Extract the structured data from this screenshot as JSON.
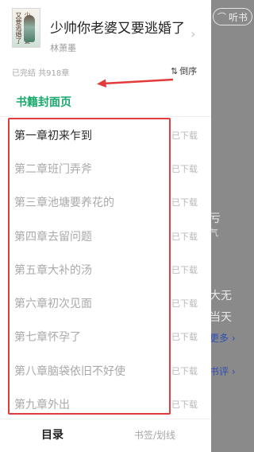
{
  "background": {
    "listen_label": "听书",
    "fragments": [
      "亏",
      "气",
      "大无",
      "当天",
      "更多 ›",
      "书评 ›"
    ]
  },
  "book": {
    "title": "少帅你老婆又要逃婚了",
    "author": "林萧墨",
    "cover_text": "少帅你老婆又要逃婚了"
  },
  "meta": {
    "status": "已完结 共918章",
    "sort_label": "倒序"
  },
  "cover_page_link": "书籍封面页",
  "chapters": [
    {
      "title": "第一章初来乍到",
      "download": "已下载"
    },
    {
      "title": "第二章班门弄斧",
      "download": "已下载"
    },
    {
      "title": "第三章池塘要养花的",
      "download": "已下载"
    },
    {
      "title": "第四章去留问题",
      "download": "已下载"
    },
    {
      "title": "第五章大补的汤",
      "download": "已下载"
    },
    {
      "title": "第六章初次见面",
      "download": "已下载"
    },
    {
      "title": "第七章怀孕了",
      "download": "已下载"
    },
    {
      "title": "第八章脑袋依旧不好使",
      "download": "已下载"
    },
    {
      "title": "第九章外出",
      "download": "已下载"
    }
  ],
  "tabs": {
    "contents": "目录",
    "bookmarks": "书签/划线"
  },
  "colors": {
    "accent_green": "#1aa96d",
    "annotation_red": "#e33a3a",
    "link_blue": "#2f4fb3"
  }
}
